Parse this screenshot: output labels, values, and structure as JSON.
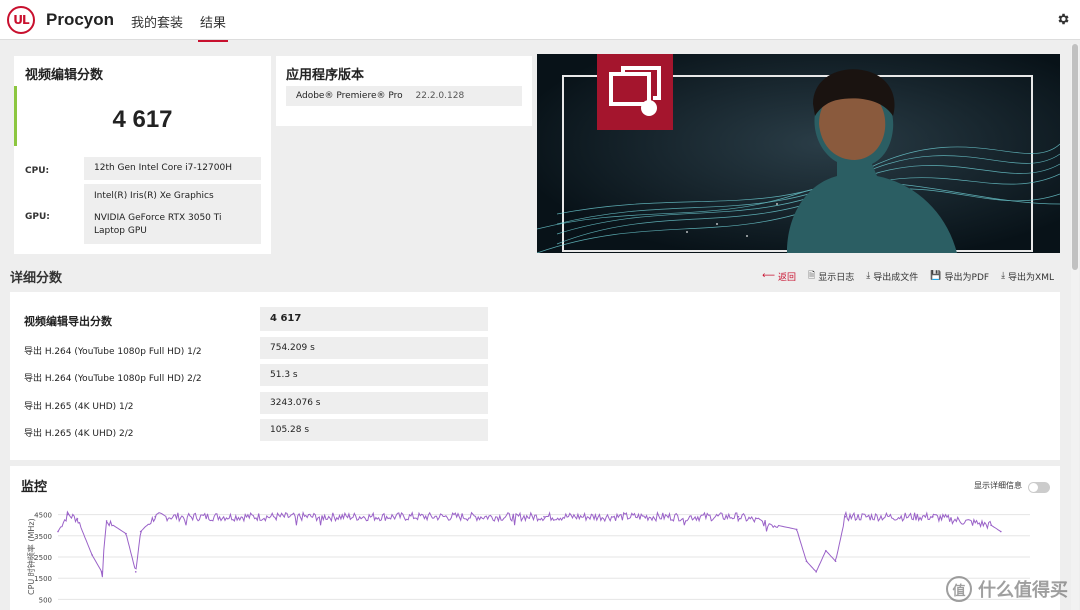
{
  "header": {
    "logo_text": "UL",
    "app_title": "Procyon",
    "nav": [
      "我的套装",
      "结果"
    ],
    "active_tab": "结果"
  },
  "score_card": {
    "title": "视频编辑分数",
    "score": "4 617",
    "cpu_label": "CPU:",
    "cpu_value": "12th Gen Intel Core i7-12700H",
    "gpu_label": "GPU:",
    "gpu_values": [
      "Intel(R) Iris(R) Xe Graphics",
      "NVIDIA GeForce RTX 3050 Ti Laptop GPU"
    ]
  },
  "app_version": {
    "title": "应用程序版本",
    "app_name": "Adobe® Premiere® Pro",
    "version": "22.2.0.128"
  },
  "details": {
    "title": "详细分数",
    "actions": [
      "返回",
      "显示日志",
      "导出成文件",
      "导出为PDF",
      "导出为XML"
    ],
    "main_label": "视频编辑导出分数",
    "main_value": "4 617",
    "rows": [
      {
        "label": "导出 H.264 (YouTube 1080p Full HD) 1/2",
        "value": "754.209 s"
      },
      {
        "label": "导出 H.264 (YouTube 1080p Full HD) 2/2",
        "value": "51.3 s"
      },
      {
        "label": "导出 H.265 (4K UHD) 1/2",
        "value": "3243.076 s"
      },
      {
        "label": "导出 H.265 (4K UHD) 2/2",
        "value": "105.28 s"
      }
    ]
  },
  "monitor": {
    "title": "监控",
    "toggle_label": "显示详细信息",
    "y_axis_label": "CPU 时钟频率 (MHz)",
    "y_ticks": [
      "4500",
      "3500",
      "2500",
      "1500",
      "500"
    ],
    "series_color": "#9a62c8"
  },
  "colors": {
    "brand_red": "#c8102e",
    "score_accent": "#8cc63f"
  },
  "watermark": {
    "icon": "值",
    "text": "什么值得买"
  },
  "chart_data": {
    "type": "line",
    "title": "",
    "xlabel": "",
    "ylabel": "CPU 时钟频率 (MHz)",
    "ylim": [
      0,
      5000
    ],
    "y_ticks": [
      4500,
      3500,
      2500,
      1500,
      500
    ],
    "x_end_fraction": 0.97,
    "series": [
      {
        "name": "",
        "baseline": 4400,
        "values": [
          {
            "x": 0.0,
            "y": 3700
          },
          {
            "x": 0.01,
            "y": 4500
          },
          {
            "x": 0.02,
            "y": 4300
          },
          {
            "x": 0.035,
            "y": 2600
          },
          {
            "x": 0.045,
            "y": 1800
          },
          {
            "x": 0.05,
            "y": 4200
          },
          {
            "x": 0.07,
            "y": 3600
          },
          {
            "x": 0.08,
            "y": 1800
          },
          {
            "x": 0.085,
            "y": 3700
          },
          {
            "x": 0.1,
            "y": 4400
          },
          {
            "x": 0.3,
            "y": 4400
          },
          {
            "x": 0.5,
            "y": 4400
          },
          {
            "x": 0.7,
            "y": 4400
          },
          {
            "x": 0.76,
            "y": 3800
          },
          {
            "x": 0.77,
            "y": 2300
          },
          {
            "x": 0.78,
            "y": 1800
          },
          {
            "x": 0.79,
            "y": 2800
          },
          {
            "x": 0.8,
            "y": 2300
          },
          {
            "x": 0.81,
            "y": 4400
          },
          {
            "x": 0.9,
            "y": 4400
          },
          {
            "x": 0.96,
            "y": 4000
          },
          {
            "x": 0.97,
            "y": 3700
          }
        ]
      }
    ]
  }
}
